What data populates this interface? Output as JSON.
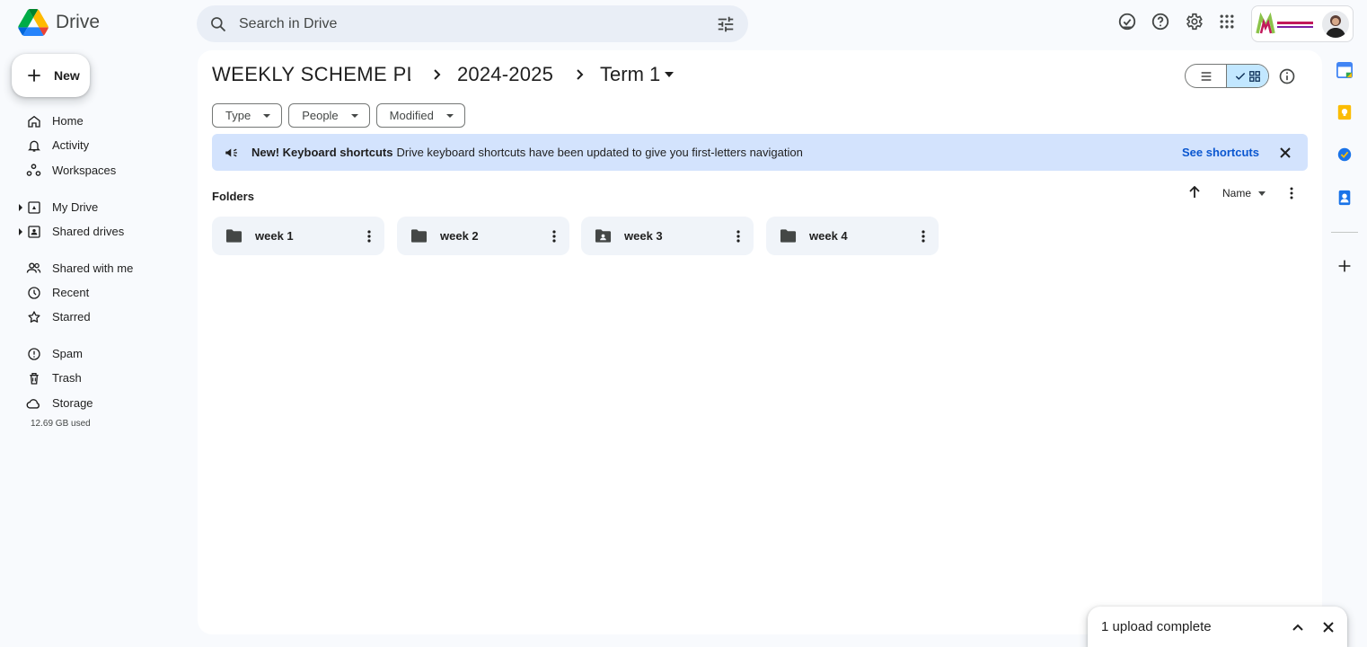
{
  "app": {
    "name": "Drive",
    "brand_colors": {
      "green": "#0f9d58",
      "blue": "#4285f4",
      "yellow": "#fbbc04",
      "red": "#ea4335"
    }
  },
  "search": {
    "placeholder": "Search in Drive"
  },
  "top_icons": [
    "offline-ready-icon",
    "help-icon",
    "settings-icon",
    "apps-grid-icon"
  ],
  "new_button": {
    "label": "New"
  },
  "nav": {
    "items": [
      {
        "label": "Home",
        "icon": "home-icon"
      },
      {
        "label": "Activity",
        "icon": "bell-icon"
      },
      {
        "label": "Workspaces",
        "icon": "workspaces-icon"
      },
      {
        "label": "My Drive",
        "icon": "my-drive-icon"
      },
      {
        "label": "Shared drives",
        "icon": "shared-drives-icon"
      },
      {
        "label": "Shared with me",
        "icon": "people-icon"
      },
      {
        "label": "Recent",
        "icon": "clock-icon"
      },
      {
        "label": "Starred",
        "icon": "star-icon"
      },
      {
        "label": "Spam",
        "icon": "spam-icon"
      },
      {
        "label": "Trash",
        "icon": "trash-icon"
      },
      {
        "label": "Storage",
        "icon": "cloud-icon"
      }
    ],
    "storage_used": "12.69 GB used"
  },
  "breadcrumb": {
    "items": [
      "WEEKLY SCHEME PLA...",
      "2024-2025",
      "Term 1"
    ]
  },
  "filters": [
    "Type",
    "People",
    "Modified"
  ],
  "banner": {
    "bold": "New! Keyboard shortcuts",
    "text": "Drive keyboard shortcuts have been updated to give you first-letters navigation",
    "link": "See shortcuts",
    "bg_color": "#d3e3fd"
  },
  "folders_section": {
    "label": "Folders",
    "sort_label": "Name"
  },
  "folders": [
    {
      "name": "week 1",
      "shared": false
    },
    {
      "name": "week 2",
      "shared": false
    },
    {
      "name": "week 3",
      "shared": true
    },
    {
      "name": "week 4",
      "shared": false
    }
  ],
  "side_panel": [
    "calendar-icon",
    "keep-icon",
    "tasks-icon",
    "contacts-icon",
    "add-icon"
  ],
  "toast": {
    "text": "1 upload complete"
  }
}
